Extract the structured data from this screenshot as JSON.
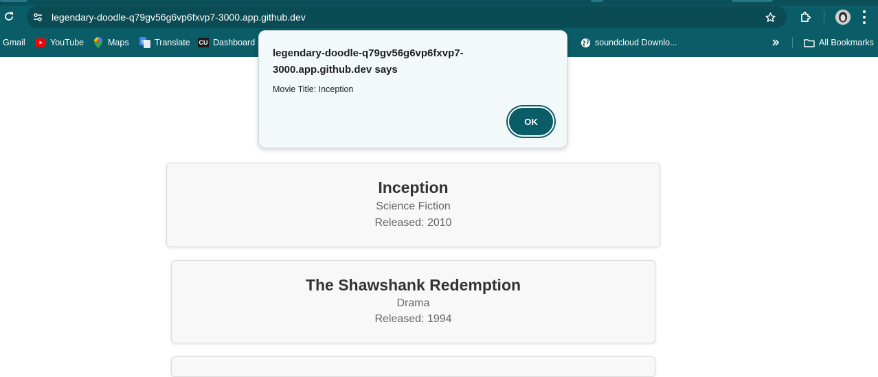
{
  "browser": {
    "url": "legendary-doodle-q79gv56g6vp6fxvp7-3000.app.github.dev",
    "theme_color": "#0a5c67",
    "bookmarks": [
      {
        "label": "Gmail",
        "icon": "gmail-icon"
      },
      {
        "label": "YouTube",
        "icon": "youtube-icon"
      },
      {
        "label": "Maps",
        "icon": "maps-icon"
      },
      {
        "label": "Translate",
        "icon": "translate-icon"
      },
      {
        "label": "Dashboard -",
        "icon": "clickup-icon",
        "icon_text": "CU"
      },
      {
        "label": "soundcloud Downlo...",
        "icon": "globe-icon"
      }
    ],
    "all_bookmarks_label": "All Bookmarks"
  },
  "dialog": {
    "title": "legendary-doodle-q79gv56g6vp6fxvp7-3000.app.github.dev says",
    "message": "Movie Title: Inception",
    "ok_label": "OK"
  },
  "movies": [
    {
      "title": "Inception",
      "genre": "Science Fiction",
      "released": "Released: 2010"
    },
    {
      "title": "The Shawshank Redemption",
      "genre": "Drama",
      "released": "Released: 1994"
    }
  ]
}
